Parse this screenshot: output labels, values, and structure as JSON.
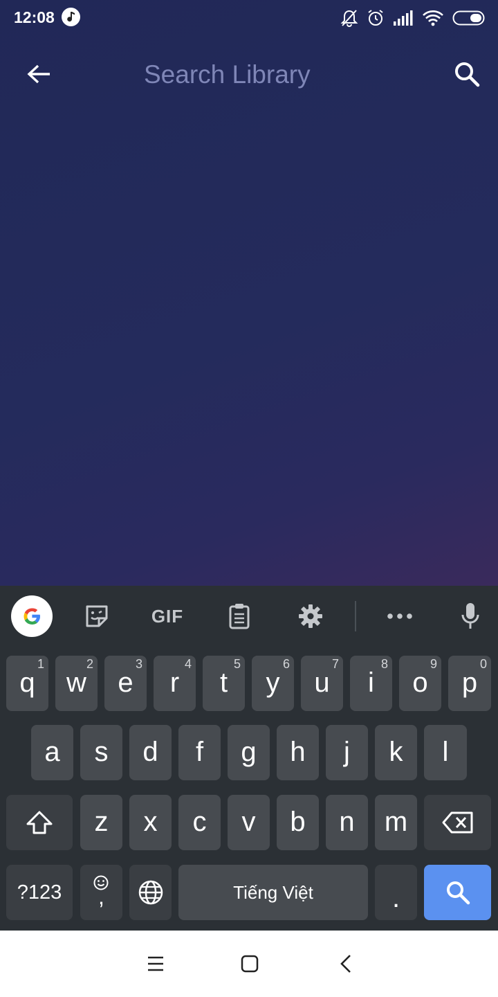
{
  "status_bar": {
    "time": "12:08",
    "icons": [
      "music-note-icon",
      "bell-off-icon",
      "alarm-icon",
      "signal-icon",
      "wifi-icon",
      "battery-icon"
    ]
  },
  "header": {
    "back_icon": "arrow-back-icon",
    "search_placeholder": "Search Library",
    "search_value": "",
    "search_icon": "search-icon"
  },
  "keyboard": {
    "toolbar": {
      "items": [
        "google-icon",
        "sticker-icon",
        "gif",
        "clipboard-icon",
        "settings-icon",
        "more-icon",
        "microphone-icon"
      ],
      "gif_label": "GIF"
    },
    "row1": [
      {
        "letter": "q",
        "hint": "1"
      },
      {
        "letter": "w",
        "hint": "2"
      },
      {
        "letter": "e",
        "hint": "3"
      },
      {
        "letter": "r",
        "hint": "4"
      },
      {
        "letter": "t",
        "hint": "5"
      },
      {
        "letter": "y",
        "hint": "6"
      },
      {
        "letter": "u",
        "hint": "7"
      },
      {
        "letter": "i",
        "hint": "8"
      },
      {
        "letter": "o",
        "hint": "9"
      },
      {
        "letter": "p",
        "hint": "0"
      }
    ],
    "row2": [
      "a",
      "s",
      "d",
      "f",
      "g",
      "h",
      "j",
      "k",
      "l"
    ],
    "row3": [
      "z",
      "x",
      "c",
      "v",
      "b",
      "n",
      "m"
    ],
    "row4": {
      "symbols_label": "?123",
      "comma_label": ",",
      "space_label": "Tiếng Việt",
      "period_label": "."
    }
  },
  "nav_bar": {
    "icons": [
      "menu-icon",
      "home-icon",
      "back-icon"
    ]
  },
  "colors": {
    "background_top": "#212857",
    "background_accent": "#3a2a5c",
    "keyboard_bg": "#2b3035",
    "key_bg": "#474b50",
    "search_key_bg": "#5b91f0",
    "placeholder": "#7f86b7"
  }
}
